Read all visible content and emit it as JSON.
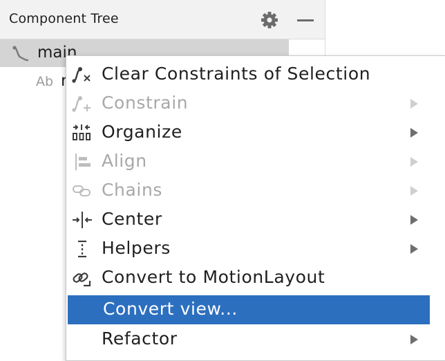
{
  "panel": {
    "title": "Component Tree",
    "tree": {
      "root_label": "main",
      "child_type_badge": "Ab",
      "child_label_partial": "r"
    }
  },
  "context_menu": {
    "items": [
      {
        "label": "Clear Constraints of Selection",
        "icon": "clear-constraints-icon",
        "enabled": true,
        "submenu": false,
        "selected": false
      },
      {
        "label": "Constrain",
        "icon": "constrain-icon",
        "enabled": false,
        "submenu": true,
        "selected": false
      },
      {
        "label": "Organize",
        "icon": "organize-icon",
        "enabled": true,
        "submenu": true,
        "selected": false
      },
      {
        "label": "Align",
        "icon": "align-icon",
        "enabled": false,
        "submenu": true,
        "selected": false
      },
      {
        "label": "Chains",
        "icon": "chains-icon",
        "enabled": false,
        "submenu": true,
        "selected": false
      },
      {
        "label": "Center",
        "icon": "center-icon",
        "enabled": true,
        "submenu": true,
        "selected": false
      },
      {
        "label": "Helpers",
        "icon": "helpers-icon",
        "enabled": true,
        "submenu": true,
        "selected": false
      },
      {
        "label": "Convert to MotionLayout",
        "icon": "convert-motion-icon",
        "enabled": true,
        "submenu": false,
        "selected": false
      },
      {
        "label": "Convert view...",
        "icon": "",
        "enabled": true,
        "submenu": false,
        "selected": true
      },
      {
        "label": "Refactor",
        "icon": "",
        "enabled": true,
        "submenu": true,
        "selected": false
      }
    ]
  },
  "colors": {
    "selection": "#2d6fbf",
    "disabled_text": "#a8a8a8",
    "tree_selection": "#d4d4d4"
  }
}
